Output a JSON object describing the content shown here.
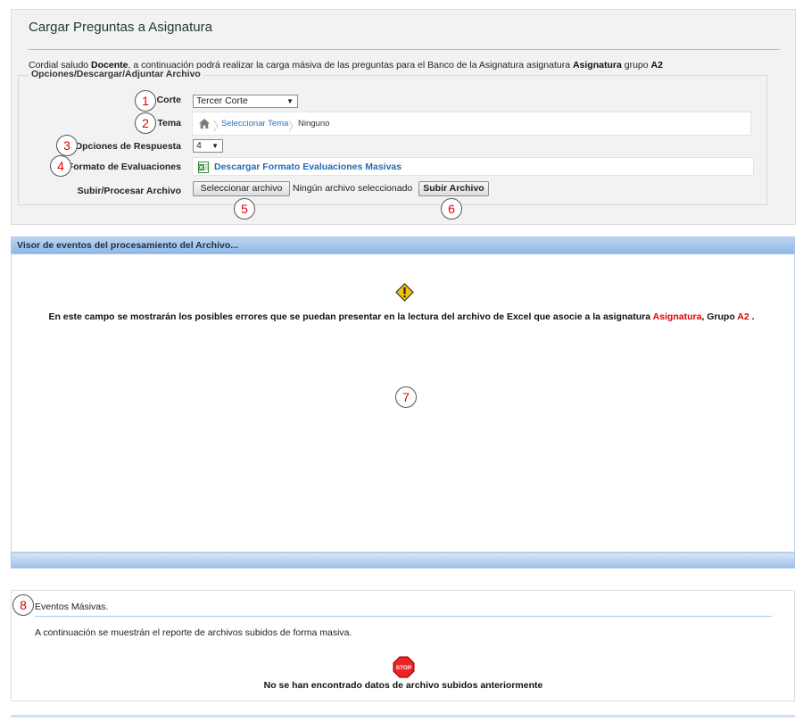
{
  "page": {
    "title": "Cargar Preguntas a Asignatura",
    "intro": {
      "p1": "Cordial saludo ",
      "role": "Docente",
      "p2": ", a continuación podrá realizar la carga másiva de las preguntas para el Banco de la Asignatura asignatura ",
      "subject": "Asignatura",
      "p3": " grupo ",
      "group": "A2"
    }
  },
  "form": {
    "legend": "Opciones/Descargar/Adjuntar Archivo",
    "corte_label": "Corte",
    "corte_value": "Tercer Corte",
    "tema_label": "Tema",
    "tema_link": "Seleccionar Tema",
    "tema_current": "Ninguno",
    "opciones_label": "Opciones de Respuesta",
    "opciones_value": "4",
    "formato_label": "Formato de Evaluaciones",
    "formato_link": "Descargar Formato Evaluaciones Masivas",
    "subir_label": "Subir/Procesar Archivo",
    "select_file_button": "Seleccionar archivo",
    "no_file_text": "Ningún archivo seleccionado",
    "upload_button": "Subir Archivo"
  },
  "viewer": {
    "header": "Visor de eventos del procesamiento del Archivo...",
    "msg_part1": "En este campo se mostrarán los posibles errores que se puedan presentar en la lectura del archivo de Excel que asocie a la asignatura ",
    "msg_subject": "Asignatura",
    "msg_part2": ", Grupo ",
    "msg_group": "A2",
    "msg_part3": " ."
  },
  "events": {
    "title": "Eventos Másivas.",
    "description": "A continuación se muestrán el reporte de archivos subidos de forma masiva.",
    "empty": "No se han encontrado datos de archivo subidos anteriormente"
  },
  "callouts": [
    "1",
    "2",
    "3",
    "4",
    "5",
    "6",
    "7",
    "8"
  ],
  "icons": {
    "home": "home-icon",
    "excel": "excel-file-icon",
    "warning": "warning-icon",
    "stop": "stop-icon",
    "select_caret": "chevron-down-icon",
    "stop_text": "STOP"
  },
  "colors": {
    "accent_link": "#1f6bb8",
    "highlight_red": "#e00000",
    "header_blue": "#8fb7e4",
    "callout_red": "#e60000"
  }
}
